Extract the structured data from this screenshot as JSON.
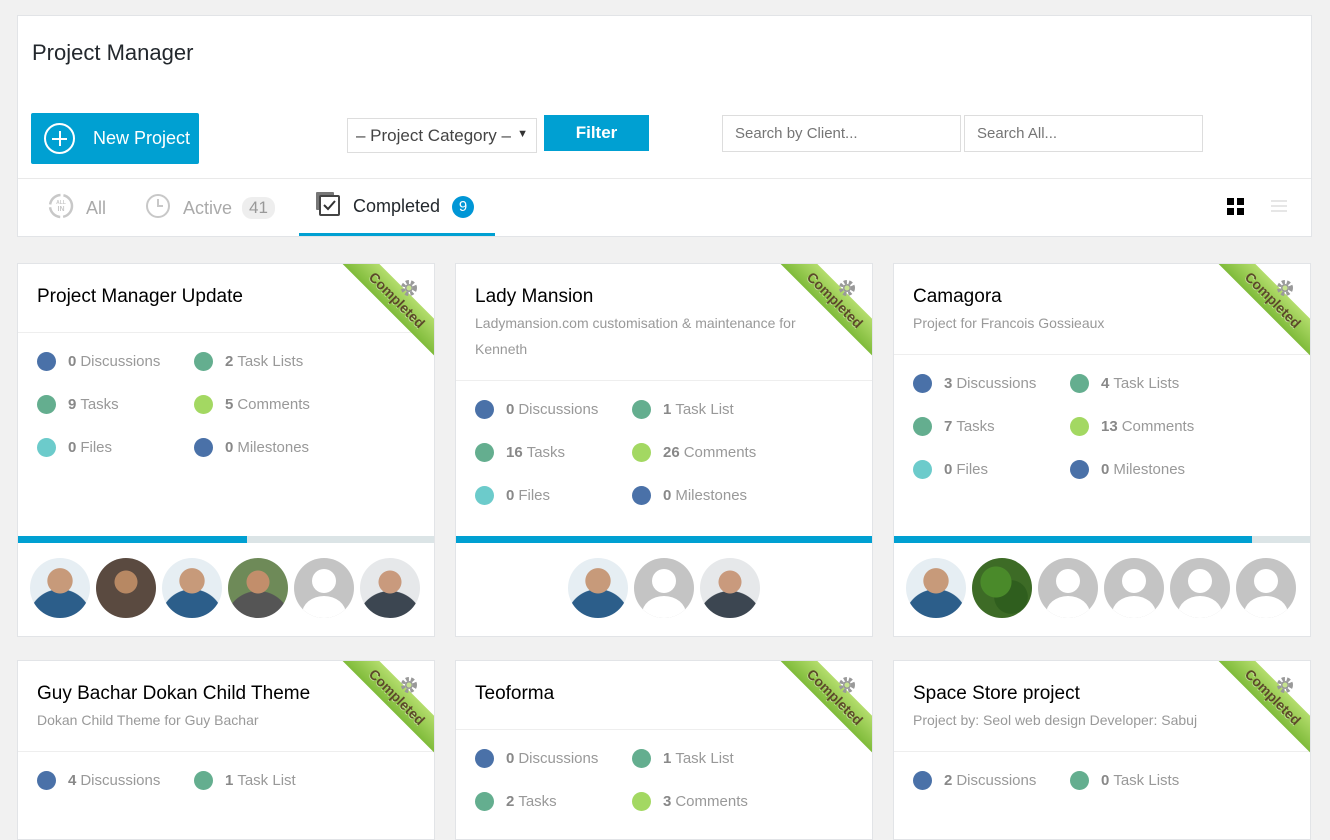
{
  "page": {
    "title": "Project Manager",
    "new_project_label": "New Project",
    "category_select": {
      "selected": "– Project Category –"
    },
    "filter_label": "Filter",
    "search_client": {
      "placeholder": "Search by Client...",
      "value": ""
    },
    "search_all": {
      "placeholder": "Search All...",
      "value": ""
    }
  },
  "tabs": [
    {
      "label": "All",
      "icon": "all-in-icon"
    },
    {
      "label": "Active",
      "count": "41",
      "icon": "clock-icon"
    },
    {
      "label": "Completed",
      "count": "9",
      "icon": "checkbox-icon",
      "selected": true
    }
  ],
  "view_toggle": {
    "grid": "grid-view-icon",
    "list": "list-view-icon",
    "selected": "grid"
  },
  "colors": {
    "accent": "#00a0d2",
    "discussions": "#4a71a8",
    "task_lists": "#64ae8f",
    "tasks": "#64ae8f",
    "comments": "#a3d862",
    "files": "#6ccbcb",
    "milestones": "#4a71a8",
    "ribbon": "#8dc447"
  },
  "projects": [
    {
      "title": "Project Manager Update",
      "description": "",
      "status": "Completed",
      "stats": {
        "discussions": {
          "count": "0",
          "label": "Discussions"
        },
        "task_lists": {
          "count": "2",
          "label": "Task Lists"
        },
        "tasks": {
          "count": "9",
          "label": "Tasks"
        },
        "comments": {
          "count": "5",
          "label": "Comments"
        },
        "files": {
          "count": "0",
          "label": "Files"
        },
        "milestones": {
          "count": "0",
          "label": "Milestones"
        }
      },
      "progress_percent": 55,
      "members": [
        "photo",
        "photo",
        "photo",
        "photo",
        "default",
        "photo"
      ]
    },
    {
      "title": "Lady Mansion",
      "description": "Ladymansion.com customisation & maintenance for Kenneth",
      "status": "Completed",
      "stats": {
        "discussions": {
          "count": "0",
          "label": "Discussions"
        },
        "task_lists": {
          "count": "1",
          "label": "Task List"
        },
        "tasks": {
          "count": "16",
          "label": "Tasks"
        },
        "comments": {
          "count": "26",
          "label": "Comments"
        },
        "files": {
          "count": "0",
          "label": "Files"
        },
        "milestones": {
          "count": "0",
          "label": "Milestones"
        }
      },
      "progress_percent": 100,
      "members": [
        "photo",
        "default",
        "photo"
      ]
    },
    {
      "title": "Camagora",
      "description": "Project for Francois Gossieaux",
      "status": "Completed",
      "stats": {
        "discussions": {
          "count": "3",
          "label": "Discussions"
        },
        "task_lists": {
          "count": "4",
          "label": "Task Lists"
        },
        "tasks": {
          "count": "7",
          "label": "Tasks"
        },
        "comments": {
          "count": "13",
          "label": "Comments"
        },
        "files": {
          "count": "0",
          "label": "Files"
        },
        "milestones": {
          "count": "0",
          "label": "Milestones"
        }
      },
      "progress_percent": 86,
      "members": [
        "photo",
        "photo",
        "default",
        "default",
        "default",
        "default"
      ]
    },
    {
      "title": "Guy Bachar Dokan Child Theme",
      "description": "Dokan Child Theme for Guy Bachar",
      "status": "Completed",
      "stats": {
        "discussions": {
          "count": "4",
          "label": "Discussions"
        },
        "task_lists": {
          "count": "1",
          "label": "Task List"
        }
      }
    },
    {
      "title": "Teoforma",
      "description": "",
      "status": "Completed",
      "stats": {
        "discussions": {
          "count": "0",
          "label": "Discussions"
        },
        "task_lists": {
          "count": "1",
          "label": "Task List"
        },
        "tasks": {
          "count": "2",
          "label": "Tasks"
        },
        "comments": {
          "count": "3",
          "label": "Comments"
        }
      }
    },
    {
      "title": "Space Store project",
      "description": "Project by: Seol web design Developer: Sabuj",
      "status": "Completed",
      "stats": {
        "discussions": {
          "count": "2",
          "label": "Discussions"
        },
        "task_lists": {
          "count": "0",
          "label": "Task Lists"
        }
      }
    }
  ]
}
